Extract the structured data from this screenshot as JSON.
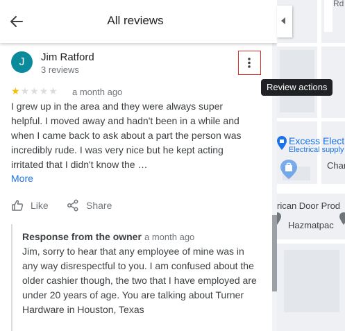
{
  "header": {
    "title": "All reviews"
  },
  "review": {
    "avatar_letter": "J",
    "avatar_color": "#0b8a9c",
    "reviewer_name": "Jim Ratford",
    "reviewer_review_count": "3 reviews",
    "rating": 1,
    "rating_max": 5,
    "date": "a month ago",
    "text": "I grew up in the area and they were always super helpful. I moved away and hadn't been in a while and when I came back to ask about a part the person was incredibly rude. I was very nice but he kept acting irritated that I didn't know the …",
    "more_label": "More",
    "like_label": "Like",
    "share_label": "Share",
    "actions_tooltip": "Review actions"
  },
  "owner_response": {
    "label": "Response from the owner",
    "date": "a month ago",
    "text": "Jim, sorry to hear that any employee of mine was in any way disrespectful to you. I am confused about the older cashier though, the two that I have employed are under 20 years of age. You are talking about Turner Hardware in Houston, Texas"
  },
  "map": {
    "road_label": "Rd",
    "place1_name": "Excess Electr",
    "place1_category": "Electrical supply",
    "place2_name": "Char",
    "place3_name": "rican Door Prod",
    "place4_name": "Hazmatpac",
    "place_color": "#1a73e8"
  }
}
